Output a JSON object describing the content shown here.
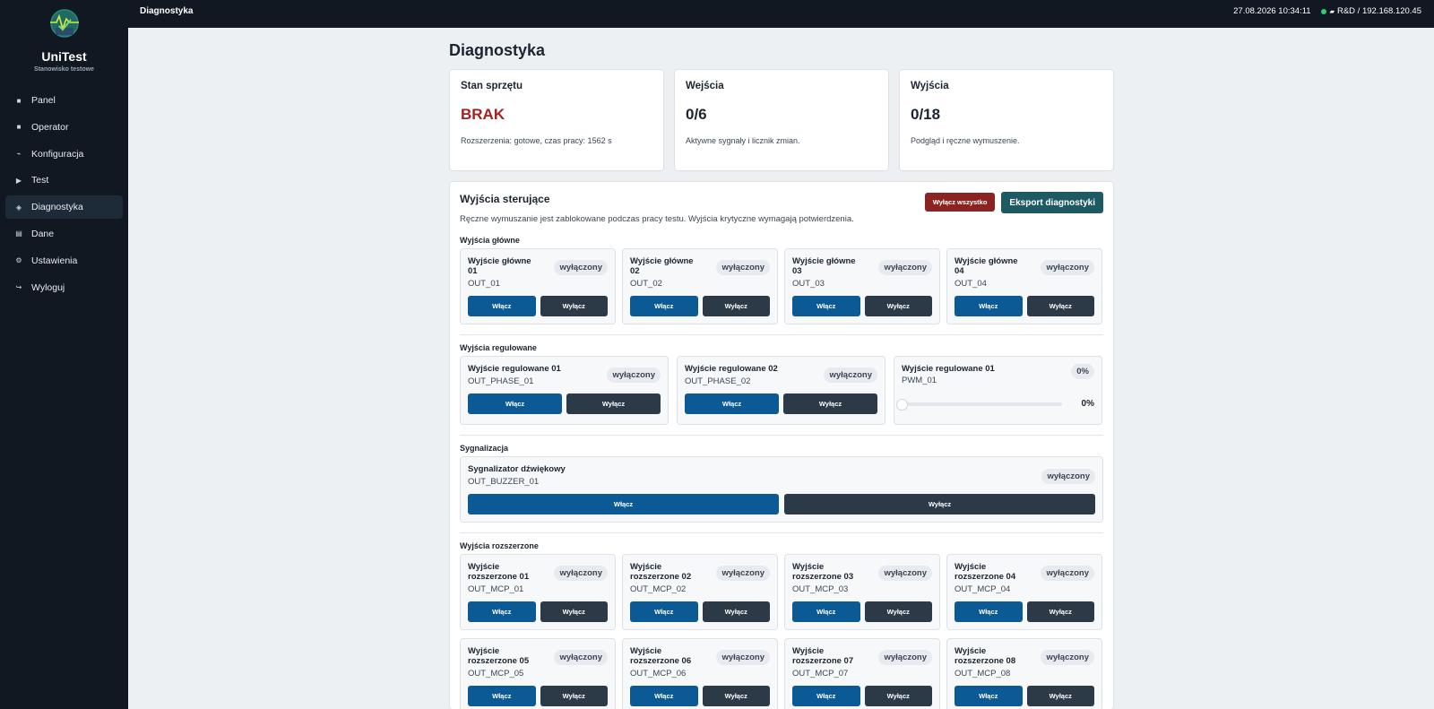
{
  "app": {
    "name": "UniTest",
    "subtitle": "Stanowisko testowe"
  },
  "nav": [
    {
      "label": "Panel",
      "icon": "square-icon",
      "glyph": "■",
      "active": false
    },
    {
      "label": "Operator",
      "icon": "square-icon",
      "glyph": "■",
      "active": false
    },
    {
      "label": "Konfiguracja",
      "icon": "wave-icon",
      "glyph": "⌁",
      "active": false
    },
    {
      "label": "Test",
      "icon": "play-icon",
      "glyph": "▶",
      "active": false
    },
    {
      "label": "Diagnostyka",
      "icon": "diamond-icon",
      "glyph": "◈",
      "active": true
    },
    {
      "label": "Dane",
      "icon": "grid-icon",
      "glyph": "▤",
      "active": false
    },
    {
      "label": "Ustawienia",
      "icon": "gear-icon",
      "glyph": "⚙",
      "active": false
    },
    {
      "label": "Wyloguj",
      "icon": "logout-icon",
      "glyph": "↪",
      "active": false
    }
  ],
  "topbar": {
    "title": "Diagnostyka",
    "datetime": "27.08.2026 10:34:11",
    "connection": "R&D / 192.168.120.45"
  },
  "page": {
    "title": "Diagnostyka"
  },
  "stats": [
    {
      "title": "Stan sprzętu",
      "value": "BRAK",
      "desc": "Rozszerzenia: gotowe, czas pracy: 1562 s"
    },
    {
      "title": "Wejścia",
      "value": "0/6",
      "desc": "Aktywne sygnały i licznik zmian."
    },
    {
      "title": "Wyjścia",
      "value": "0/18",
      "desc": "Podgląd i ręczne wymuszenie."
    }
  ],
  "panel": {
    "title": "Wyjścia sterujące",
    "desc": "Ręczne wymuszanie jest zablokowane podczas pracy testu. Wyjścia krytyczne wymagają potwierdzenia.",
    "disable_all": "Wyłącz wszystko",
    "export": "Eksport diagnostyki"
  },
  "labels": {
    "on": "Włącz",
    "off": "Wyłącz",
    "state_off": "wyłączony"
  },
  "main_outputs": {
    "title": "Wyjścia główne",
    "items": [
      {
        "name": "Wyjście główne 01",
        "code": "OUT_01"
      },
      {
        "name": "Wyjście główne 02",
        "code": "OUT_02"
      },
      {
        "name": "Wyjście główne 03",
        "code": "OUT_03"
      },
      {
        "name": "Wyjście główne 04",
        "code": "OUT_04"
      }
    ]
  },
  "regulated": {
    "title": "Wyjścia regulowane",
    "items": [
      {
        "name": "Wyjście regulowane 01",
        "code": "OUT_PHASE_01"
      },
      {
        "name": "Wyjście regulowane 02",
        "code": "OUT_PHASE_02"
      }
    ],
    "pwm": {
      "name": "Wyjście regulowane 01",
      "code": "PWM_01",
      "badge": "0%",
      "value": "0%",
      "level": 0
    }
  },
  "signaling": {
    "title": "Sygnalizacja",
    "item": {
      "name": "Sygnalizator dźwiękowy",
      "code": "OUT_BUZZER_01"
    }
  },
  "extended": {
    "title": "Wyjścia rozszerzone",
    "items": [
      {
        "name": "Wyjście rozszerzone 01",
        "code": "OUT_MCP_01"
      },
      {
        "name": "Wyjście rozszerzone 02",
        "code": "OUT_MCP_02"
      },
      {
        "name": "Wyjście rozszerzone 03",
        "code": "OUT_MCP_03"
      },
      {
        "name": "Wyjście rozszerzone 04",
        "code": "OUT_MCP_04"
      },
      {
        "name": "Wyjście rozszerzone 05",
        "code": "OUT_MCP_05"
      },
      {
        "name": "Wyjście rozszerzone 06",
        "code": "OUT_MCP_06"
      },
      {
        "name": "Wyjście rozszerzone 07",
        "code": "OUT_MCP_07"
      },
      {
        "name": "Wyjście rozszerzone 08",
        "code": "OUT_MCP_08"
      }
    ]
  },
  "colors": {
    "sidebar": "#111821",
    "primary": "#0b5a96",
    "danger": "#8c2323",
    "export": "#1d5a64",
    "error_text": "#a3221f"
  }
}
